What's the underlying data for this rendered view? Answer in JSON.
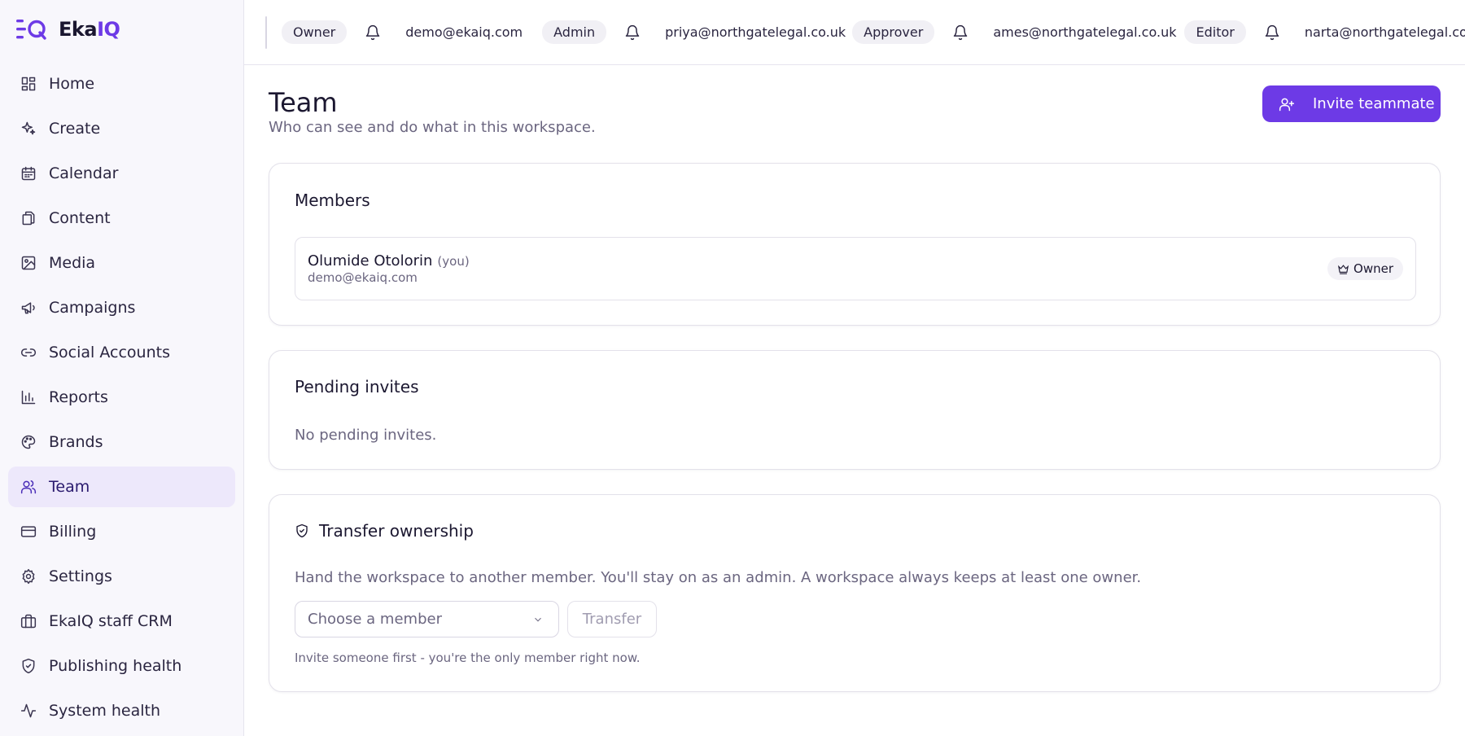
{
  "app": {
    "name_prefix": "Eka",
    "name_suffix": "IQ",
    "brand_color": "#6d3ae6"
  },
  "sidebar": {
    "items": [
      {
        "label": "Home",
        "icon": "home-grid-icon"
      },
      {
        "label": "Create",
        "icon": "sparkle-icon"
      },
      {
        "label": "Calendar",
        "icon": "calendar-icon"
      },
      {
        "label": "Content",
        "icon": "files-icon"
      },
      {
        "label": "Media",
        "icon": "image-icon"
      },
      {
        "label": "Campaigns",
        "icon": "megaphone-icon"
      },
      {
        "label": "Social Accounts",
        "icon": "link-icon"
      },
      {
        "label": "Reports",
        "icon": "bar-chart-icon"
      },
      {
        "label": "Brands",
        "icon": "palette-icon"
      },
      {
        "label": "Team",
        "icon": "users-icon",
        "active": true
      },
      {
        "label": "Billing",
        "icon": "credit-card-icon"
      },
      {
        "label": "Settings",
        "icon": "gear-icon"
      },
      {
        "label": "EkaIQ staff CRM",
        "icon": "briefcase-icon"
      },
      {
        "label": "Publishing health",
        "icon": "shield-check-icon"
      },
      {
        "label": "System health",
        "icon": "activity-icon"
      }
    ]
  },
  "topbar": {
    "box_text": "gate",
    "text1": "gate",
    "badge1": "Owner",
    "email1": "demo@ekaiq.com",
    "badge2": "Admin",
    "email2": "priya@northgatelegal.co.uk",
    "badge3": "Approver",
    "email3": "ames@northgatelegal.co.uk",
    "badge4": "Editor",
    "email4": "narta@northgatelegal.co.uk"
  },
  "header": {
    "title": "Team",
    "subtitle": "Who can see and do what in this workspace.",
    "invite_label": "Invite teammate"
  },
  "members": {
    "title": "Members",
    "rows": [
      {
        "name": "Olumide Otolorin",
        "you": "(you)",
        "email": "demo@ekaiq.com",
        "role": "Owner"
      }
    ]
  },
  "pending": {
    "title": "Pending invites",
    "empty": "No pending invites."
  },
  "transfer": {
    "title": "Transfer ownership",
    "description": "Hand the workspace to another member. You'll stay on as an admin. A workspace always keeps at least one owner.",
    "select_placeholder": "Choose a member",
    "button_label": "Transfer",
    "hint": "Invite someone first - you're the only member right now."
  }
}
